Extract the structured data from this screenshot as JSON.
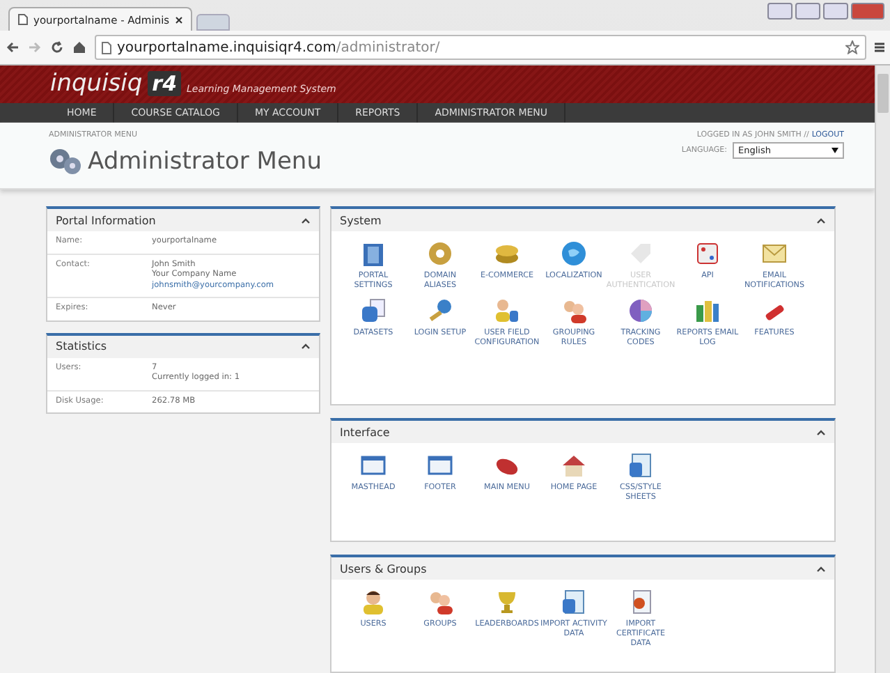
{
  "browser": {
    "tab_title": "yourportalname - Adminis",
    "url_host": "yourportalname.inquisiqr4.com",
    "url_path": "/administrator/"
  },
  "header": {
    "logo_text": "inquisiq",
    "logo_badge": "r4",
    "tagline": "Learning Management System"
  },
  "nav": [
    "HOME",
    "COURSE CATALOG",
    "MY ACCOUNT",
    "REPORTS",
    "ADMINISTRATOR MENU"
  ],
  "breadcrumb": "ADMINISTRATOR MENU",
  "login": {
    "text": "LOGGED IN AS JOHN SMITH //",
    "link": "LOGOUT"
  },
  "language": {
    "label": "LANGUAGE:",
    "value": "English"
  },
  "page_title": "Administrator Menu",
  "info_panels": [
    {
      "title": "Portal Information",
      "expanded": true,
      "rows": [
        {
          "label": "Name:",
          "lines": [
            {
              "kind": "text",
              "text": "yourportalname"
            }
          ]
        },
        {
          "label": "Contact:",
          "lines": [
            {
              "kind": "text",
              "text": "John Smith"
            },
            {
              "kind": "text",
              "text": "Your Company Name"
            },
            {
              "kind": "link",
              "text": "johnsmith@yourcompany.com"
            }
          ]
        },
        {
          "label": "Expires:",
          "lines": [
            {
              "kind": "text",
              "text": "Never"
            }
          ]
        }
      ]
    },
    {
      "title": "Statistics",
      "expanded": true,
      "rows": [
        {
          "label": "Users:",
          "lines": [
            {
              "kind": "text",
              "text": "7"
            },
            {
              "kind": "text",
              "text": "Currently logged in: 1"
            }
          ]
        },
        {
          "label": "Disk Usage:",
          "lines": [
            {
              "kind": "text",
              "text": "262.78 MB"
            }
          ]
        }
      ]
    }
  ],
  "tool_panels": [
    {
      "title": "System",
      "expanded": true,
      "tools": [
        {
          "label": "PORTAL SETTINGS",
          "disabled": false
        },
        {
          "label": "DOMAIN ALIASES",
          "disabled": false
        },
        {
          "label": "E-COMMERCE",
          "disabled": false
        },
        {
          "label": "LOCALIZATION",
          "disabled": false
        },
        {
          "label": "USER AUTHENTICATION",
          "disabled": true
        },
        {
          "label": "API",
          "disabled": false
        },
        {
          "label": "EMAIL NOTIFICATIONS",
          "disabled": false
        },
        {
          "label": "DATASETS",
          "disabled": false
        },
        {
          "label": "LOGIN SETUP",
          "disabled": false
        },
        {
          "label": "USER FIELD CONFIGURATION",
          "disabled": false
        },
        {
          "label": "GROUPING RULES",
          "disabled": false
        },
        {
          "label": "TRACKING CODES",
          "disabled": false
        },
        {
          "label": "REPORTS EMAIL LOG",
          "disabled": false
        },
        {
          "label": "FEATURES",
          "disabled": false
        }
      ]
    },
    {
      "title": "Interface",
      "expanded": true,
      "tools": [
        {
          "label": "MASTHEAD",
          "disabled": false
        },
        {
          "label": "FOOTER",
          "disabled": false
        },
        {
          "label": "MAIN MENU",
          "disabled": false
        },
        {
          "label": "HOME PAGE",
          "disabled": false
        },
        {
          "label": "CSS/STYLE SHEETS",
          "disabled": false
        }
      ]
    },
    {
      "title": "Users & Groups",
      "expanded": true,
      "tools": [
        {
          "label": "USERS",
          "disabled": false
        },
        {
          "label": "GROUPS",
          "disabled": false
        },
        {
          "label": "LEADERBOARDS",
          "disabled": false
        },
        {
          "label": "IMPORT ACTIVITY DATA",
          "disabled": false
        },
        {
          "label": "IMPORT CERTIFICATE DATA",
          "disabled": false
        }
      ]
    }
  ]
}
